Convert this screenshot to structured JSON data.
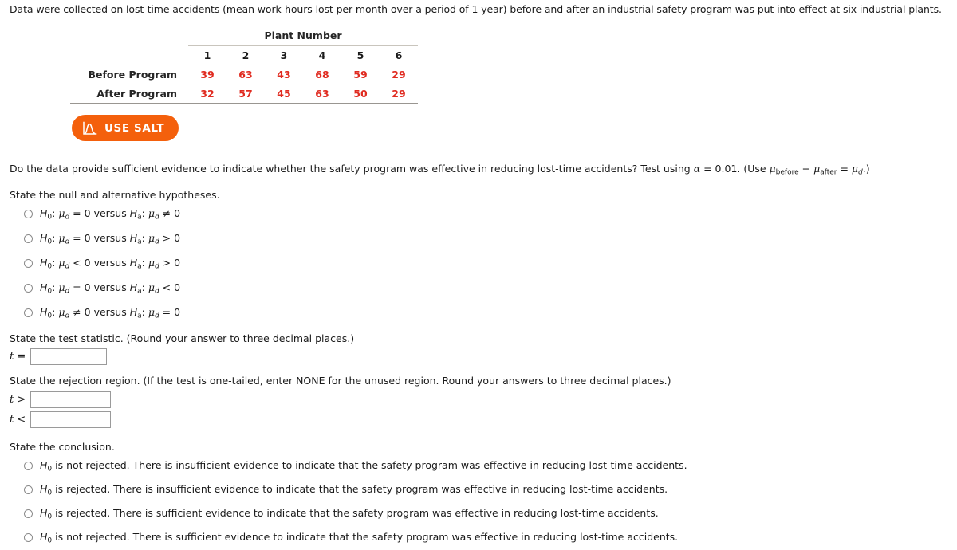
{
  "intro": "Data were collected on lost-time accidents (mean work-hours lost per month over a period of 1 year) before and after an industrial safety program was put into effect at six industrial plants.",
  "table": {
    "span_header": "Plant Number",
    "column_headers": [
      "1",
      "2",
      "3",
      "4",
      "5",
      "6"
    ],
    "rows": [
      {
        "label": "Before Program",
        "values": [
          "39",
          "63",
          "43",
          "68",
          "59",
          "29"
        ]
      },
      {
        "label": "After Program",
        "values": [
          "32",
          "57",
          "45",
          "63",
          "50",
          "29"
        ]
      }
    ],
    "value_color": "#e02b20"
  },
  "salt_button": {
    "label": "USE SALT",
    "icon": "distribution-curve-icon",
    "background": "#f4600c",
    "text_color": "#ffffff"
  },
  "question": {
    "part1": "Do the data provide sufficient evidence to indicate whether the safety program was effective in reducing lost-time accidents? Test using ",
    "alpha_symbol": "α",
    "alpha_eq": " = 0.01. (Use ",
    "mu_symbol": "μ",
    "sub_before": "before",
    "minus": " − ",
    "sub_after": "after",
    "equals": " = ",
    "sub_d": "d",
    "close": ".)"
  },
  "sections": {
    "hypotheses": "State the null and alternative hypotheses.",
    "test_statistic": "State the test statistic. (Round your answer to three decimal places.)",
    "rejection_region": "State the rejection region. (If the test is one-tailed, enter NONE for the unused region. Round your answers to three decimal places.)",
    "conclusion": "State the conclusion."
  },
  "hypothesis_options": [
    {
      "h0_rel": "=",
      "h0_val": "0",
      "versus": "versus",
      "ha_rel": "≠",
      "ha_val": "0"
    },
    {
      "h0_rel": "=",
      "h0_val": "0",
      "versus": "versus",
      "ha_rel": ">",
      "ha_val": "0"
    },
    {
      "h0_rel": "<",
      "h0_val": "0",
      "versus": "versus",
      "ha_rel": ">",
      "ha_val": "0"
    },
    {
      "h0_rel": "=",
      "h0_val": "0",
      "versus": "versus",
      "ha_rel": "<",
      "ha_val": "0"
    },
    {
      "h0_rel": "≠",
      "h0_val": "0",
      "versus": "versus",
      "ha_rel": "=",
      "ha_val": "0"
    }
  ],
  "answers": {
    "t_equals_label": "=",
    "t_greater_label": ">",
    "t_less_label": "<",
    "t_symbol": "t",
    "t_value": "",
    "t_upper_value": "",
    "t_lower_value": "",
    "placeholder": ""
  },
  "conclusion_options": [
    "is not rejected. There is insufficient evidence to indicate that the safety program was effective in reducing lost-time accidents.",
    "is rejected. There is insufficient evidence to indicate that the safety program was effective in reducing lost-time accidents.",
    "is rejected. There is sufficient evidence to indicate that the safety program was effective in reducing lost-time accidents.",
    "is not rejected. There is sufficient evidence to indicate that the safety program was effective in reducing lost-time accidents."
  ],
  "symbols": {
    "H": "H",
    "sub_0": "0",
    "sub_a": "a"
  }
}
